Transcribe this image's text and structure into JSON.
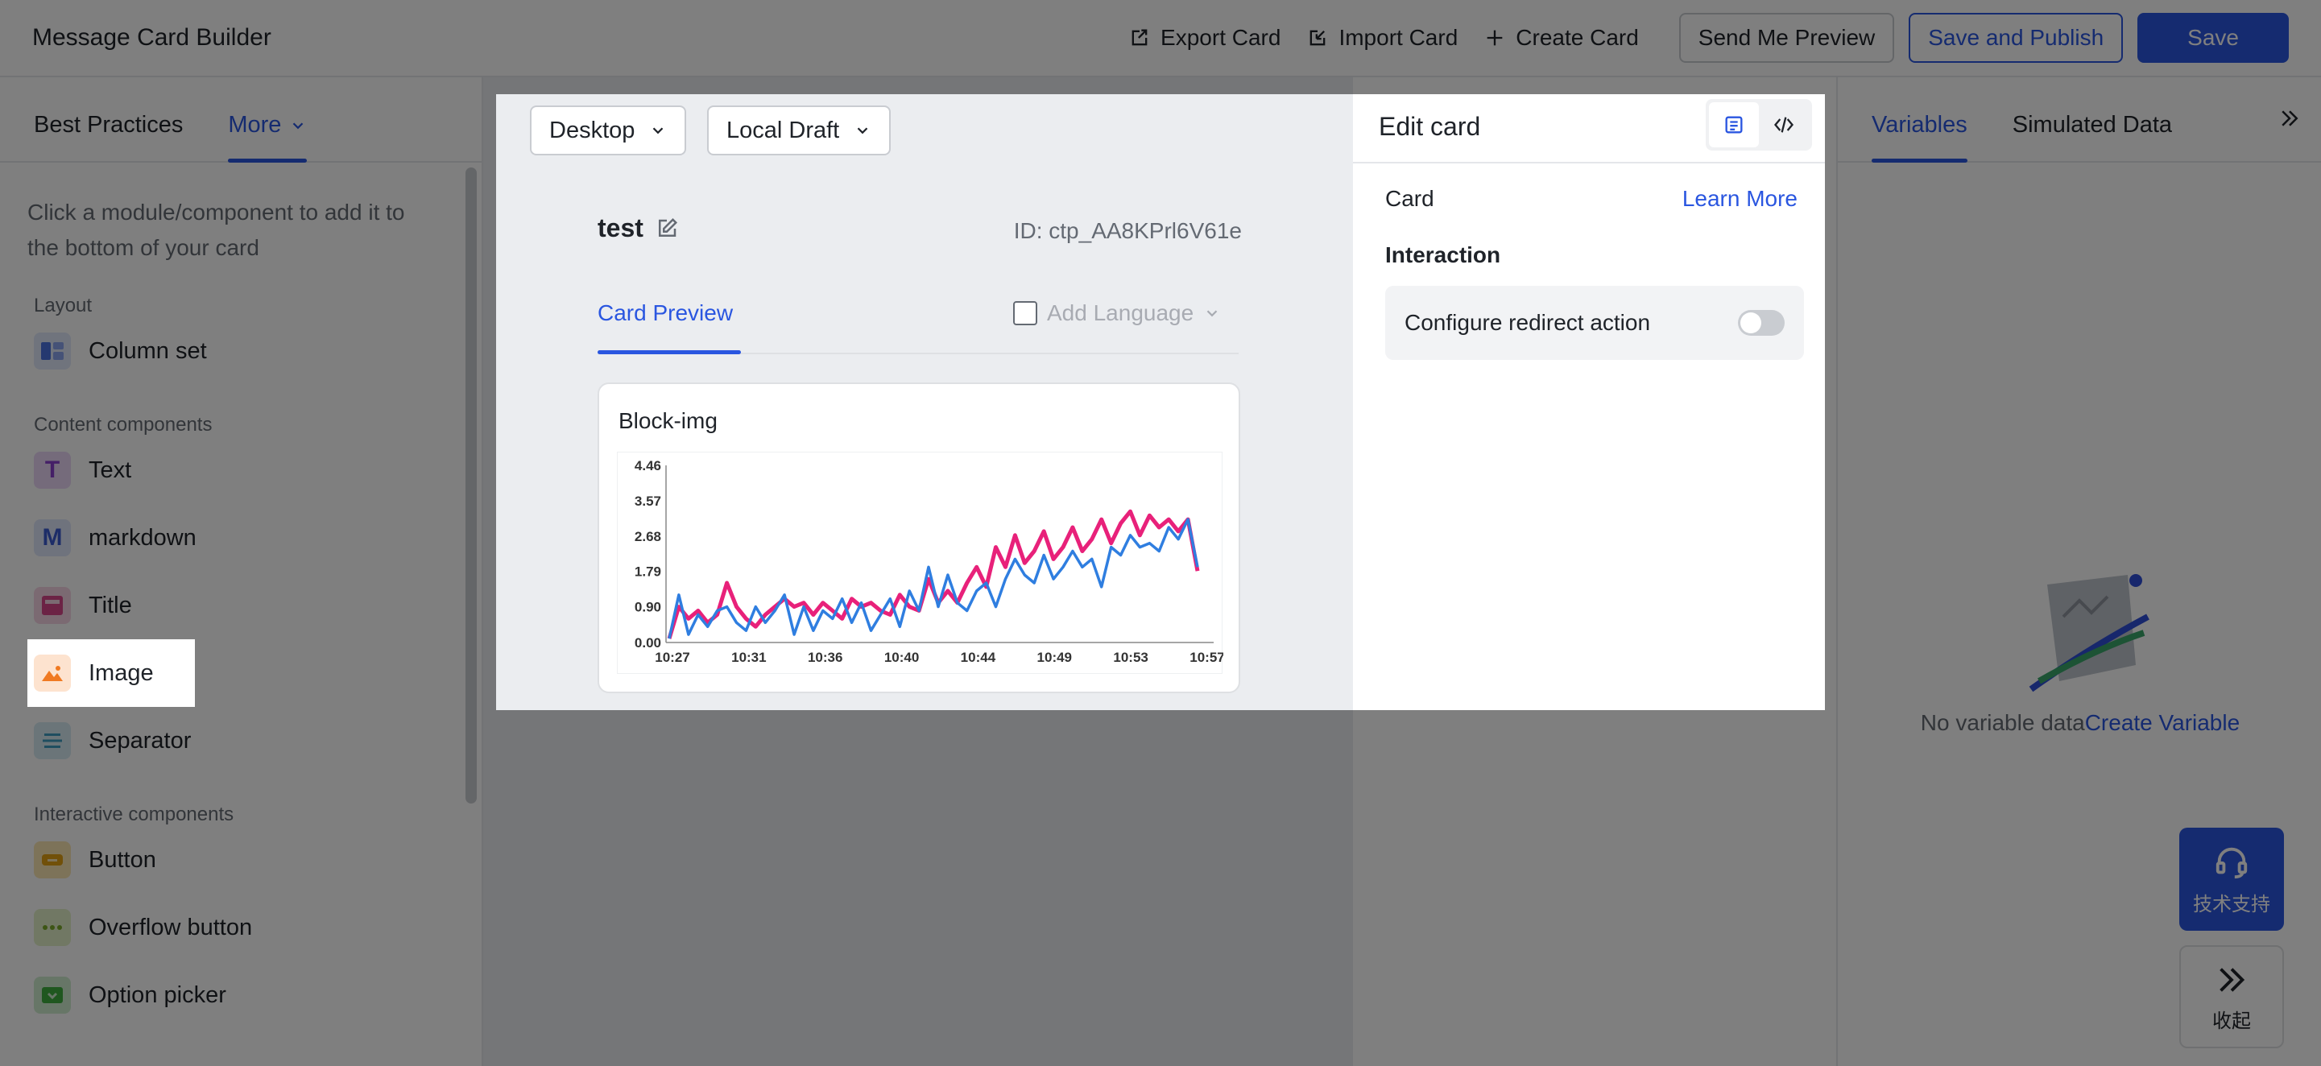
{
  "header": {
    "app_title": "Message Card Builder",
    "export_label": "Export Card",
    "import_label": "Import Card",
    "create_label": "Create Card",
    "send_preview_label": "Send Me Preview",
    "save_publish_label": "Save and Publish",
    "save_label": "Save"
  },
  "left_panel": {
    "tabs": [
      {
        "label": "Best Practices"
      },
      {
        "label": "More"
      }
    ],
    "hint": "Click a module/component to add it to the bottom of your card",
    "groups": {
      "layout": {
        "title": "Layout",
        "items": [
          {
            "label": "Column set"
          }
        ]
      },
      "content": {
        "title": "Content components",
        "items": [
          {
            "label": "Text"
          },
          {
            "label": "markdown"
          },
          {
            "label": "Title"
          },
          {
            "label": "Image"
          },
          {
            "label": "Separator"
          }
        ]
      },
      "interactive": {
        "title": "Interactive components",
        "items": [
          {
            "label": "Button"
          },
          {
            "label": "Overflow button"
          },
          {
            "label": "Option picker"
          }
        ]
      }
    }
  },
  "canvas": {
    "device_select": "Desktop",
    "draft_select": "Local Draft",
    "card_name": "test",
    "card_id": "ID: ctp_AA8KPrl6V61e",
    "preview_tab": "Card Preview",
    "add_language": "Add Language",
    "block_label": "Block-img"
  },
  "edit_panel": {
    "title": "Edit card",
    "card_label": "Card",
    "learn_more": "Learn More",
    "interaction": "Interaction",
    "redirect_label": "Configure redirect action",
    "redirect_enabled": false
  },
  "right_panel": {
    "tabs": [
      {
        "label": "Variables"
      },
      {
        "label": "Simulated Data"
      }
    ],
    "empty_text": "No variable data",
    "create_link": "Create Variable"
  },
  "floating": {
    "support_label": "技术支持",
    "collapse_label": "收起"
  },
  "colors": {
    "accent": "#2a56e0",
    "series_pink": "#e8217a",
    "series_blue": "#2f7ee0"
  },
  "chart_data": {
    "type": "line",
    "title": "",
    "x_ticks": [
      "10:27",
      "10:31",
      "10:36",
      "10:40",
      "10:44",
      "10:49",
      "10:53",
      "10:57"
    ],
    "y_ticks": [
      "0.00",
      "0.90",
      "1.79",
      "2.68",
      "3.57",
      "4.46"
    ],
    "ylim": [
      0,
      4.46
    ],
    "grid": false,
    "series": [
      {
        "color": "#e8217a",
        "values": [
          0.1,
          0.9,
          0.6,
          0.8,
          0.5,
          0.7,
          1.5,
          0.9,
          0.6,
          0.4,
          0.7,
          0.9,
          1.1,
          0.9,
          1.0,
          0.7,
          1.0,
          0.8,
          0.6,
          1.1,
          0.9,
          1.0,
          0.8,
          0.7,
          1.2,
          0.9,
          0.8,
          1.6,
          1.0,
          1.3,
          1.0,
          1.5,
          1.9,
          1.4,
          2.4,
          1.9,
          2.7,
          2.0,
          2.3,
          2.8,
          2.1,
          2.4,
          2.9,
          2.3,
          2.6,
          3.1,
          2.5,
          3.0,
          3.3,
          2.7,
          3.2,
          2.9,
          3.1,
          2.8,
          3.1,
          1.8
        ]
      },
      {
        "color": "#2f7ee0",
        "values": [
          0.1,
          1.2,
          0.2,
          0.7,
          0.4,
          0.8,
          0.9,
          0.5,
          0.3,
          0.9,
          0.5,
          0.8,
          1.2,
          0.2,
          0.9,
          0.3,
          0.8,
          0.6,
          1.1,
          0.5,
          1.0,
          0.3,
          0.7,
          1.1,
          0.4,
          1.3,
          0.8,
          1.9,
          0.9,
          1.7,
          1.0,
          0.8,
          1.3,
          1.5,
          0.9,
          1.6,
          2.1,
          1.7,
          1.5,
          2.2,
          1.6,
          1.9,
          2.3,
          1.9,
          2.1,
          1.4,
          2.4,
          2.2,
          2.7,
          2.4,
          2.5,
          2.3,
          2.9,
          2.6,
          3.1,
          1.9
        ]
      }
    ]
  }
}
